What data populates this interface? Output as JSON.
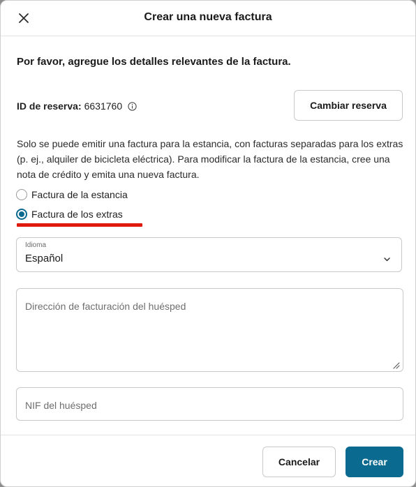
{
  "dialog": {
    "title": "Crear una nueva factura",
    "close_icon": "close-icon"
  },
  "intro": "Por favor, agregue los detalles relevantes de la factura.",
  "reservation": {
    "label": "ID de reserva:",
    "value": "6631760",
    "info_icon": "info-icon",
    "change_button": "Cambiar reserva"
  },
  "description": "Solo se puede emitir una factura para la estancia, con facturas separadas para los extras (p. ej., alquiler de bicicleta eléctrica). Para modificar la factura de la estancia, cree una nota de crédito y emita una nueva factura.",
  "invoice_type": {
    "options": [
      {
        "label": "Factura de la estancia",
        "checked": false
      },
      {
        "label": "Factura de los extras",
        "checked": true
      }
    ],
    "annotation_color": "#e0190d"
  },
  "language": {
    "label": "Idioma",
    "value": "Español",
    "chevron_icon": "chevron-down-icon"
  },
  "billing_address": {
    "placeholder": "Dirección de facturación del huésped",
    "value": ""
  },
  "tax_id": {
    "placeholder": "NIF del huésped",
    "value": ""
  },
  "footer": {
    "cancel": "Cancelar",
    "create": "Crear"
  },
  "colors": {
    "primary": "#0a6a8f",
    "border": "#c9c9c9",
    "text": "#1a1a1a"
  }
}
